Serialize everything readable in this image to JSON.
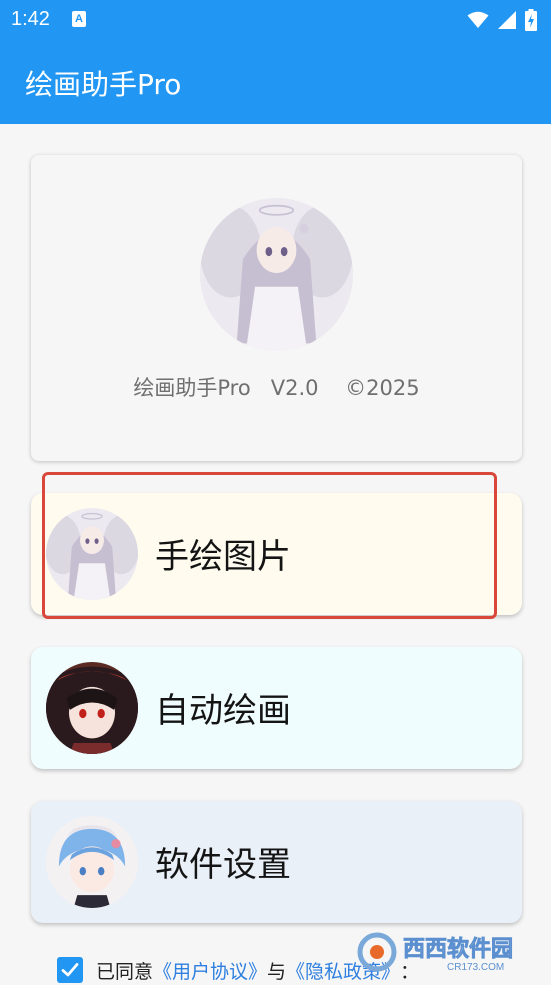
{
  "status_bar": {
    "time": "1:42",
    "notification_icon": "A"
  },
  "app_bar": {
    "title": "绘画助手Pro"
  },
  "header": {
    "version_text": "绘画助手Pro   V2.0    ©2025"
  },
  "menu": [
    {
      "label": "手绘图片",
      "icon": "angel-girl-avatar"
    },
    {
      "label": "自动绘画",
      "icon": "red-eye-girl-avatar"
    },
    {
      "label": "软件设置",
      "icon": "blue-hair-girl-avatar"
    }
  ],
  "agreement": {
    "prefix": "已同意",
    "user_agreement": "《用户协议》",
    "and": "与",
    "privacy_policy": "《隐私政策》",
    "suffix": "："
  },
  "watermark": {
    "brand": "西西软件园",
    "site": "CR173.COM"
  },
  "colors": {
    "primary": "#2196f3",
    "highlight": "#d9473a",
    "link": "#2f7fe0",
    "card_draw": "#fffcef",
    "card_auto": "#f0fdff",
    "card_settings": "#eaf0f7"
  }
}
